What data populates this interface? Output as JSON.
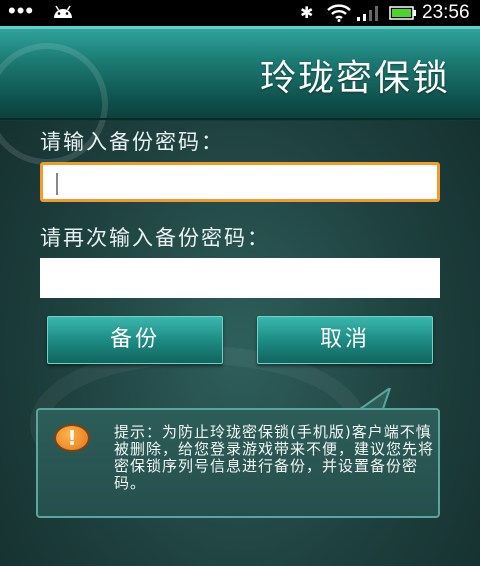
{
  "status_bar": {
    "dots": "•••",
    "time": "23:56",
    "icons": [
      "android-icon",
      "bluetooth-icon",
      "wifi-icon",
      "signal-icon",
      "battery-icon"
    ]
  },
  "header": {
    "title": "玲珑密保锁"
  },
  "form": {
    "label_password": "请输入备份密码：",
    "label_confirm": "请再次输入备份密码：",
    "password_value": "",
    "confirm_value": ""
  },
  "buttons": {
    "backup": "备份",
    "cancel": "取消"
  },
  "tip": {
    "text": "提示：为防止玲珑密保锁(手机版)客户端不慎被删除，给您登录游戏带来不便，建议您先将密保锁序列号信息进行备份，并设置备份密码。",
    "icon": "exclamation-icon"
  },
  "colors": {
    "accent_focus": "#f39a2d",
    "button_teal": "#1d8c84",
    "background": "#1d3f3d"
  }
}
